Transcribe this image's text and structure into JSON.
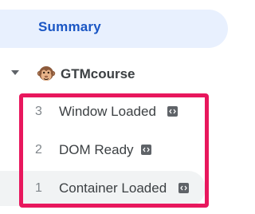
{
  "nav": {
    "summary_label": "Summary"
  },
  "container": {
    "name": "GTMcourse",
    "expanded": true,
    "icon": "monkey-emoji-icon",
    "events": [
      {
        "number": "3",
        "label": "Window Loaded",
        "icon": "code-icon"
      },
      {
        "number": "2",
        "label": "DOM Ready",
        "icon": "code-icon"
      },
      {
        "number": "1",
        "label": "Container Loaded",
        "icon": "code-icon"
      }
    ]
  },
  "colors": {
    "summary_bg": "#e8f0fe",
    "summary_text": "#1a56c4",
    "highlight_border": "#e8175d",
    "selected_row_bg": "#f1f3f4"
  }
}
